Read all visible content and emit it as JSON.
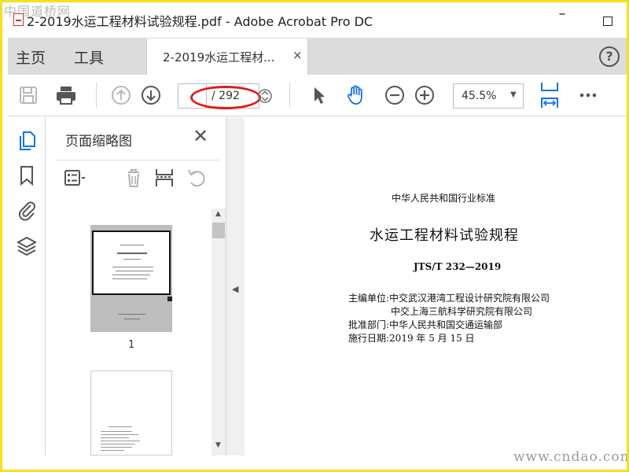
{
  "window": {
    "watermark_top": "中国道桥网",
    "title": "2-2019水运工程材料试验规程.pdf - Adobe Acrobat Pro DC",
    "minimize": "–",
    "close": "✕"
  },
  "tabs": {
    "home": "主页",
    "tools": "工具",
    "document_tab": "2-2019水运工程材...",
    "document_tab_close": "×",
    "help": "?"
  },
  "toolbar": {
    "current_page": "",
    "page_total": "/ 292",
    "zoom": "45.5%",
    "zoom_caret": "▼",
    "icons": [
      "save-icon",
      "print-icon",
      "prev-page-icon",
      "next-page-icon",
      "page-stepper-icon",
      "select-tool-icon",
      "hand-tool-icon",
      "zoom-out-icon",
      "zoom-in-icon",
      "fit-width-icon",
      "more-icon"
    ]
  },
  "sidebar": {
    "icons": [
      "page-thumbnails-icon",
      "bookmark-icon",
      "attachments-icon",
      "layers-icon"
    ]
  },
  "thumbnail_panel": {
    "title": "页面缩略图",
    "close": "✕",
    "page_number_1": "1",
    "scroll_up": "▲",
    "scroll_down": "▼"
  },
  "document": {
    "header": "中华人民共和国行业标准",
    "title": "水运工程材料试验规程",
    "code": "JTS/T 232—2019",
    "line1": "主编单位:中交武汉港湾工程设计研究院有限公司",
    "line2": "中交上海三航科学研究院有限公司",
    "line3": "批准部门:中华人民共和国交通运输部",
    "line4": "施行日期:2019 年 5 月 15 日"
  },
  "footer": {
    "watermark_bottom": "www.cndao.com"
  },
  "colors": {
    "frame": "#f5e01e",
    "accent_blue": "#1473e6",
    "annotation_red": "#e01b1b",
    "tabbar": "#dcdcdc"
  }
}
